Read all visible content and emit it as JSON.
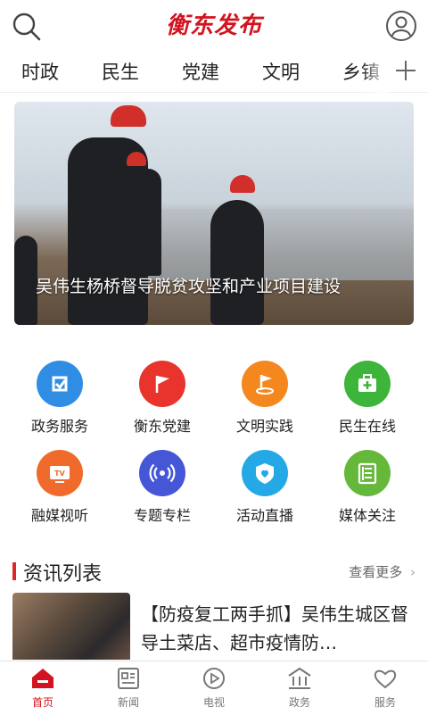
{
  "header": {
    "logo_text": "衡东发布"
  },
  "nav_tabs": [
    "时政",
    "民生",
    "党建",
    "文明",
    "乡镇"
  ],
  "banner": {
    "caption": "吴伟生杨桥督导脱贫攻坚和产业项目建设"
  },
  "services": [
    {
      "label": "政务服务",
      "icon": "government-service-icon",
      "color": "#2f8de4"
    },
    {
      "label": "衡东党建",
      "icon": "party-flag-icon",
      "color": "#e8342c"
    },
    {
      "label": "文明实践",
      "icon": "civilization-flag-icon",
      "color": "#f5871f"
    },
    {
      "label": "民生在线",
      "icon": "medical-kit-icon",
      "color": "#3db43a"
    },
    {
      "label": "融媒视听",
      "icon": "tv-icon",
      "color": "#f06a2b"
    },
    {
      "label": "专题专栏",
      "icon": "broadcast-icon",
      "color": "#4557d6"
    },
    {
      "label": "活动直播",
      "icon": "heart-shield-icon",
      "color": "#25a9e6"
    },
    {
      "label": "媒体关注",
      "icon": "document-icon",
      "color": "#65b83a"
    }
  ],
  "news_section": {
    "title": "资讯列表",
    "more_label": "查看更多"
  },
  "news_items": [
    {
      "title": "【防疫复工两手抓】吴伟生城区督导土菜店、超市疫情防…"
    }
  ],
  "bottom_nav": [
    {
      "label": "首页",
      "icon": "home-icon",
      "active": true
    },
    {
      "label": "新闻",
      "icon": "newspaper-icon",
      "active": false
    },
    {
      "label": "电视",
      "icon": "play-icon",
      "active": false
    },
    {
      "label": "政务",
      "icon": "government-building-icon",
      "active": false
    },
    {
      "label": "服务",
      "icon": "heart-icon",
      "active": false
    }
  ],
  "colors": {
    "brand_red": "#d3131f",
    "text_dark": "#222222",
    "text_gray": "#777777"
  }
}
